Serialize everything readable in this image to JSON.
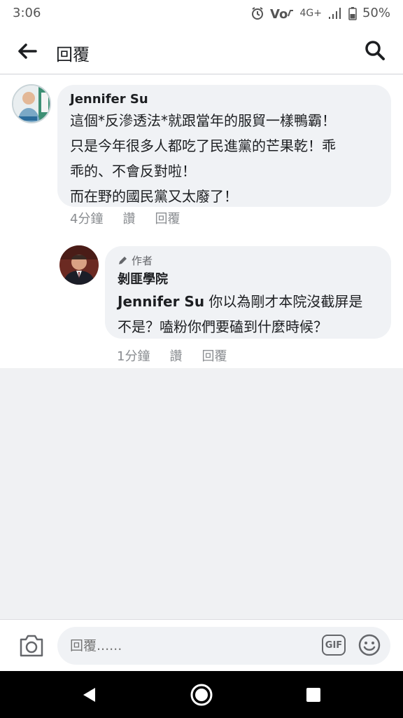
{
  "status_bar": {
    "time": "3:06",
    "network": "4G+",
    "battery": "50%",
    "icons": [
      "alarm-icon",
      "volte-icon",
      "signal-icon",
      "battery-icon"
    ]
  },
  "header": {
    "title": "回覆",
    "back_icon": "arrow-left-icon",
    "search_icon": "search-icon"
  },
  "comments": [
    {
      "author": "Jennifer Su",
      "text": "這個*反滲透法*就跟當年的服貿一樣鴨霸！\n只是今年很多人都吃了民進黨的芒果乾！乖\n乖的、不會反對啦！\n而在野的國民黨又太廢了！",
      "time": "4分鐘",
      "like": "讚",
      "reply": "回覆"
    },
    {
      "badge": "作者",
      "author": "剝匪學院",
      "text": "Jennifer Su 你以為剛才本院沒截屏是\n不是？嗑粉你們要磕到什麼時候？",
      "mention": "Jennifer Su",
      "text_rest": " 你以為剛才本院沒截屏是\n不是？嗑粉你們要磕到什麼時候？",
      "time": "1分鐘",
      "like": "讚",
      "reply": "回覆"
    }
  ],
  "composer": {
    "placeholder": "回覆......",
    "gif_label": "GIF"
  },
  "colors": {
    "bubble": "#f0f2f5",
    "meta": "#8a8d91",
    "nav": "#000000"
  }
}
